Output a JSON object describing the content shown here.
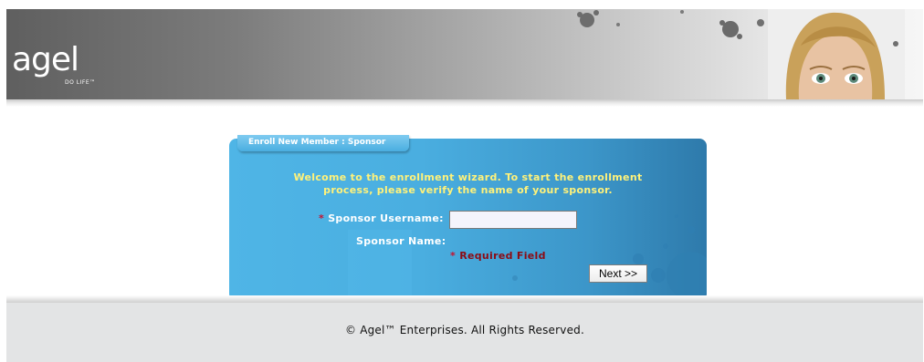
{
  "header": {
    "logo_text": "agel",
    "tagline": "DO LIFE™"
  },
  "enrollment": {
    "tab_title": "Enroll New Member : Sponsor",
    "welcome_line1": "Welcome to the enrollment wizard. To start the enrollment",
    "welcome_line2": "process, please verify the name of your sponsor.",
    "required_marker": "*",
    "sponsor_username_label": "Sponsor Username:",
    "sponsor_username_value": "",
    "sponsor_name_label": "Sponsor Name:",
    "sponsor_name_value": "",
    "required_note": "Required Field",
    "next_button": "Next >>"
  },
  "footer": {
    "copyright": "© Agel™ Enterprises. All Rights Reserved."
  },
  "colors": {
    "panel": "#4aaee0",
    "welcome_text": "#fff27a",
    "required_star": "#c8102e",
    "required_note": "#8c0b14",
    "footer_bg": "#e3e4e5"
  }
}
